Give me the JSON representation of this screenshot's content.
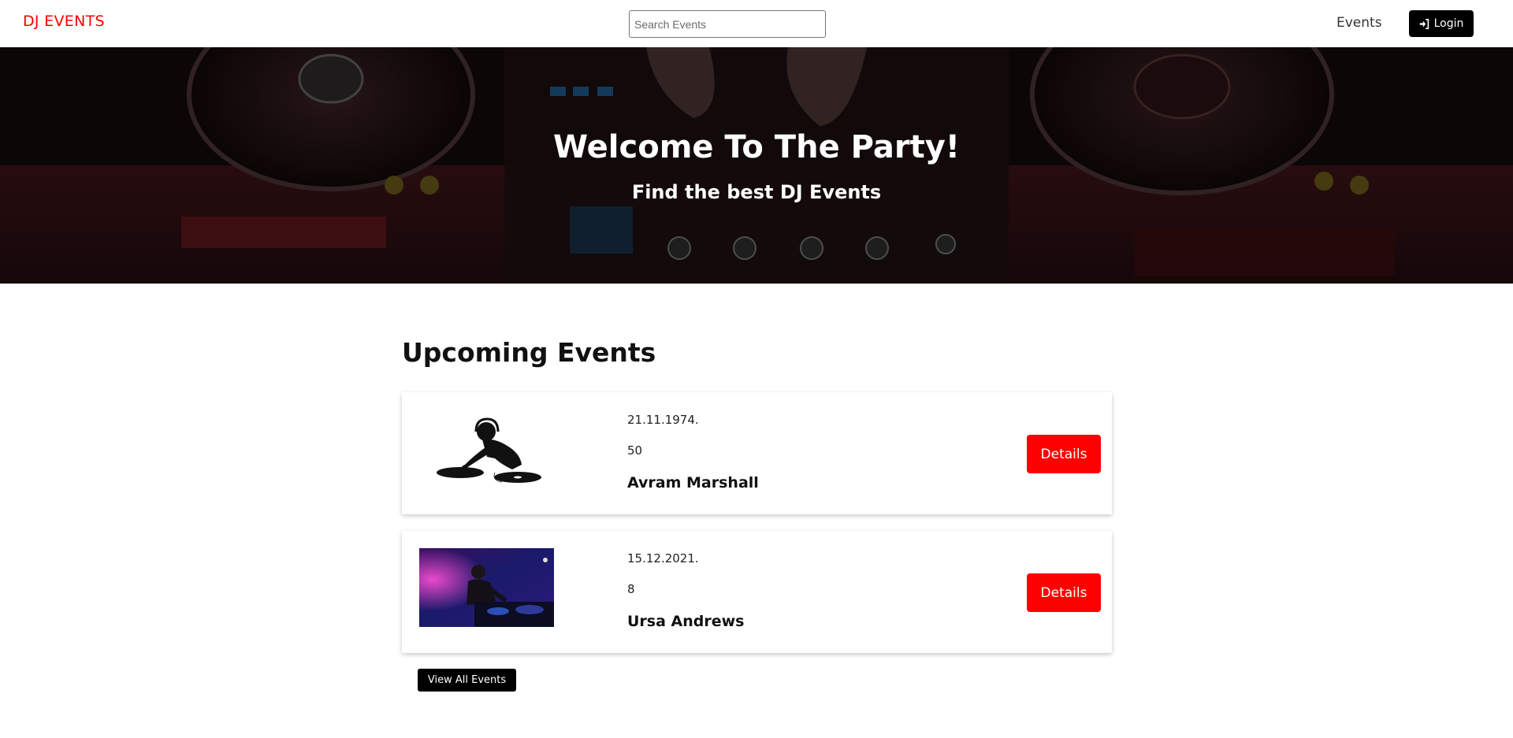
{
  "header": {
    "logo": "DJ EVENTS",
    "search_placeholder": "Search Events",
    "nav_events": "Events",
    "login_label": "Login"
  },
  "hero": {
    "title": "Welcome To The Party!",
    "subtitle": "Find the best DJ Events"
  },
  "main": {
    "section_title": "Upcoming Events",
    "events": [
      {
        "date": "21.11.1974.",
        "count": "50",
        "name": "Avram Marshall",
        "button": "Details",
        "image": "dj-silhouette-image"
      },
      {
        "date": "15.12.2021.",
        "count": "8",
        "name": "Ursa Andrews",
        "button": "Details",
        "image": "dj-club-photo"
      }
    ],
    "view_all_label": "View All Events"
  },
  "colors": {
    "brand": "#ff0000",
    "button_dark": "#000000",
    "details_button": "#ff0000"
  },
  "icons": {
    "login": "sign-in-icon"
  }
}
